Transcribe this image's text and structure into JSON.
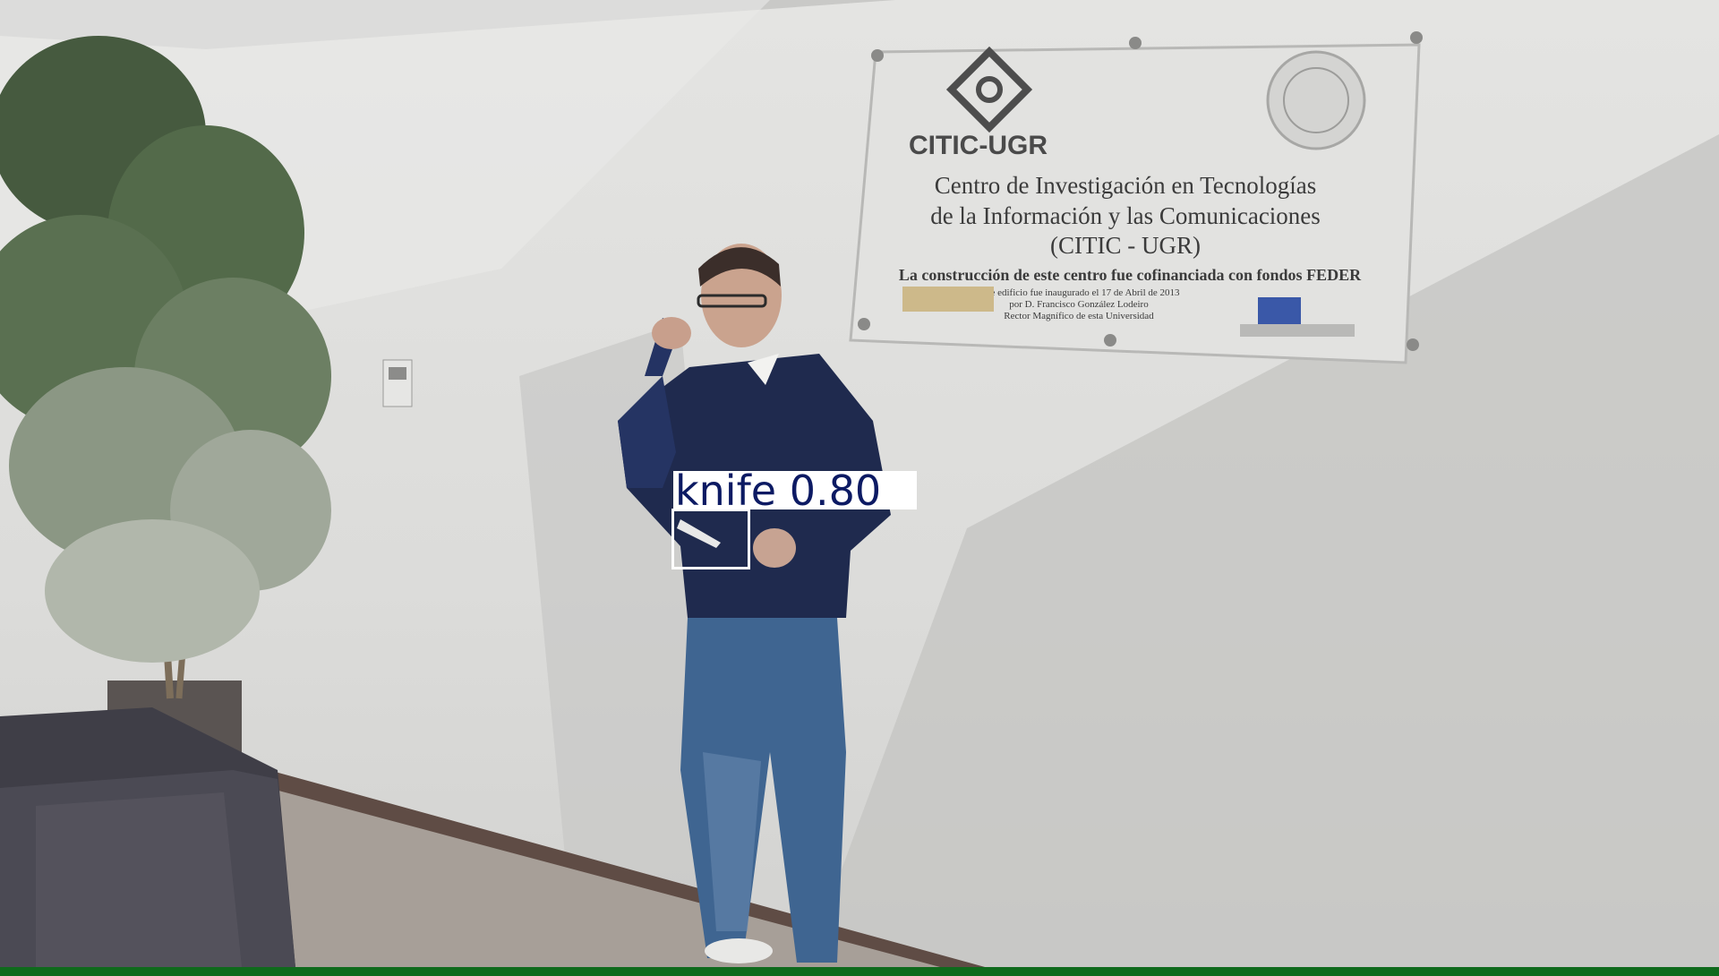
{
  "scene": {
    "plaque": {
      "logo_text": "CITIC-UGR",
      "title_lines": [
        "Centro de Investigación en Tecnologías",
        "de la Información y las Comunicaciones",
        "(CITIC - UGR)"
      ],
      "funding_line": "La construcción de este centro fue cofinanciada con fondos FEDER",
      "small_lines": [
        "Este edificio fue inaugurado el 17 de Abril de 2013",
        "por D. Francisco González Lodeiro",
        "Rector Magnífico de esta Universidad"
      ]
    }
  },
  "detection": {
    "label": "knife",
    "confidence": "0.80",
    "box_color": "#ffffff",
    "label_text_color": "#0c1a63"
  },
  "colors": {
    "wall": "#dcdcda",
    "sweater": "#1f2a4e",
    "jeans": "#3f6591",
    "bottom_bar": "#0f6a1c"
  }
}
